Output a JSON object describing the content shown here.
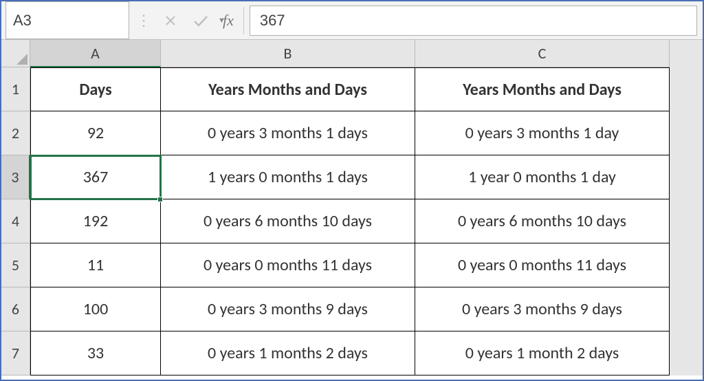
{
  "formulaBar": {
    "nameBox": "A3",
    "fx": "fx",
    "value": "367"
  },
  "columns": [
    "A",
    "B",
    "C"
  ],
  "activeColumn": "A",
  "activeRow": 3,
  "selectedCell": "A3",
  "rows": [
    {
      "num": "1",
      "A": "Days",
      "B": "Years Months and Days",
      "C": "Years Months and Days",
      "isHeader": true
    },
    {
      "num": "2",
      "A": "92",
      "B": "0 years 3 months 1 days",
      "C": "0 years 3 months 1 day"
    },
    {
      "num": "3",
      "A": "367",
      "B": "1 years 0 months 1 days",
      "C": "1 year 0 months 1 day"
    },
    {
      "num": "4",
      "A": "192",
      "B": "0 years 6 months 10 days",
      "C": "0 years 6 months 10 days"
    },
    {
      "num": "5",
      "A": "11",
      "B": "0 years 0 months 11 days",
      "C": "0 years 0 months 11 days"
    },
    {
      "num": "6",
      "A": "100",
      "B": "0 years 3 months 9 days",
      "C": "0 years 3 months 9 days"
    },
    {
      "num": "7",
      "A": "33",
      "B": "0 years 1 months 2 days",
      "C": "0 years 1 month 2 days"
    }
  ]
}
